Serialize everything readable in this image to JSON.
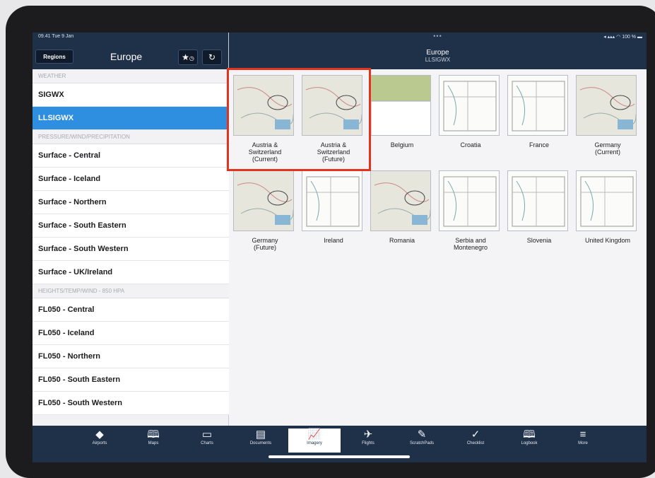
{
  "status": {
    "time_date": "09.41 Tue 9 Jan",
    "right": "100 %"
  },
  "left_panel": {
    "regions_label": "Regions",
    "title": "Europe",
    "favorites_icon": "star-clock-icon",
    "refresh_icon": "refresh-icon",
    "sections": [
      {
        "header": "WEATHER",
        "items": [
          "SIGWX",
          "LLSIGWX"
        ]
      },
      {
        "header": "PRESSURE/WIND/PRECIPITATION",
        "items": [
          "Surface - Central",
          "Surface - Iceland",
          "Surface - Northern",
          "Surface - South Eastern",
          "Surface - South Western",
          "Surface - UK/Ireland"
        ]
      },
      {
        "header": "HEIGHTS/TEMP/WIND - 850 HPA",
        "items": [
          "FL050 - Central",
          "FL050 - Iceland",
          "FL050 - Northern",
          "FL050 - South Eastern",
          "FL050 - South Western"
        ]
      }
    ],
    "selected_item": "LLSIGWX"
  },
  "right_panel": {
    "title": "Europe",
    "subtitle": "LLSIGWX",
    "tiles": [
      {
        "l1": "Austria &",
        "l2": "Switzerland",
        "l3": "(Current)"
      },
      {
        "l1": "Austria &",
        "l2": "Switzerland",
        "l3": "(Future)"
      },
      {
        "l1": "Belgium",
        "l2": "",
        "l3": ""
      },
      {
        "l1": "Croatia",
        "l2": "",
        "l3": ""
      },
      {
        "l1": "France",
        "l2": "",
        "l3": ""
      },
      {
        "l1": "Germany",
        "l2": "(Current)",
        "l3": ""
      },
      {
        "l1": "Germany",
        "l2": "(Future)",
        "l3": ""
      },
      {
        "l1": "Ireland",
        "l2": "",
        "l3": ""
      },
      {
        "l1": "Romania",
        "l2": "",
        "l3": ""
      },
      {
        "l1": "Serbia and",
        "l2": "Montenegro",
        "l3": ""
      },
      {
        "l1": "Slovenia",
        "l2": "",
        "l3": ""
      },
      {
        "l1": "United Kingdom",
        "l2": "",
        "l3": ""
      }
    ]
  },
  "tabs": [
    {
      "label": "Airports",
      "icon": "airport-icon"
    },
    {
      "label": "Maps",
      "icon": "map-icon"
    },
    {
      "label": "Charts",
      "icon": "charts-icon"
    },
    {
      "label": "Documents",
      "icon": "documents-icon"
    },
    {
      "label": "Imagery",
      "icon": "imagery-icon",
      "active": true
    },
    {
      "label": "Flights",
      "icon": "flights-icon"
    },
    {
      "label": "ScratchPads",
      "icon": "scratchpad-icon"
    },
    {
      "label": "Checklist",
      "icon": "checklist-icon"
    },
    {
      "label": "Logbook",
      "icon": "logbook-icon"
    },
    {
      "label": "More",
      "icon": "more-icon"
    }
  ],
  "colors": {
    "header": "#1f3049",
    "selected": "#2e8fe0",
    "highlight": "#e3321e"
  }
}
